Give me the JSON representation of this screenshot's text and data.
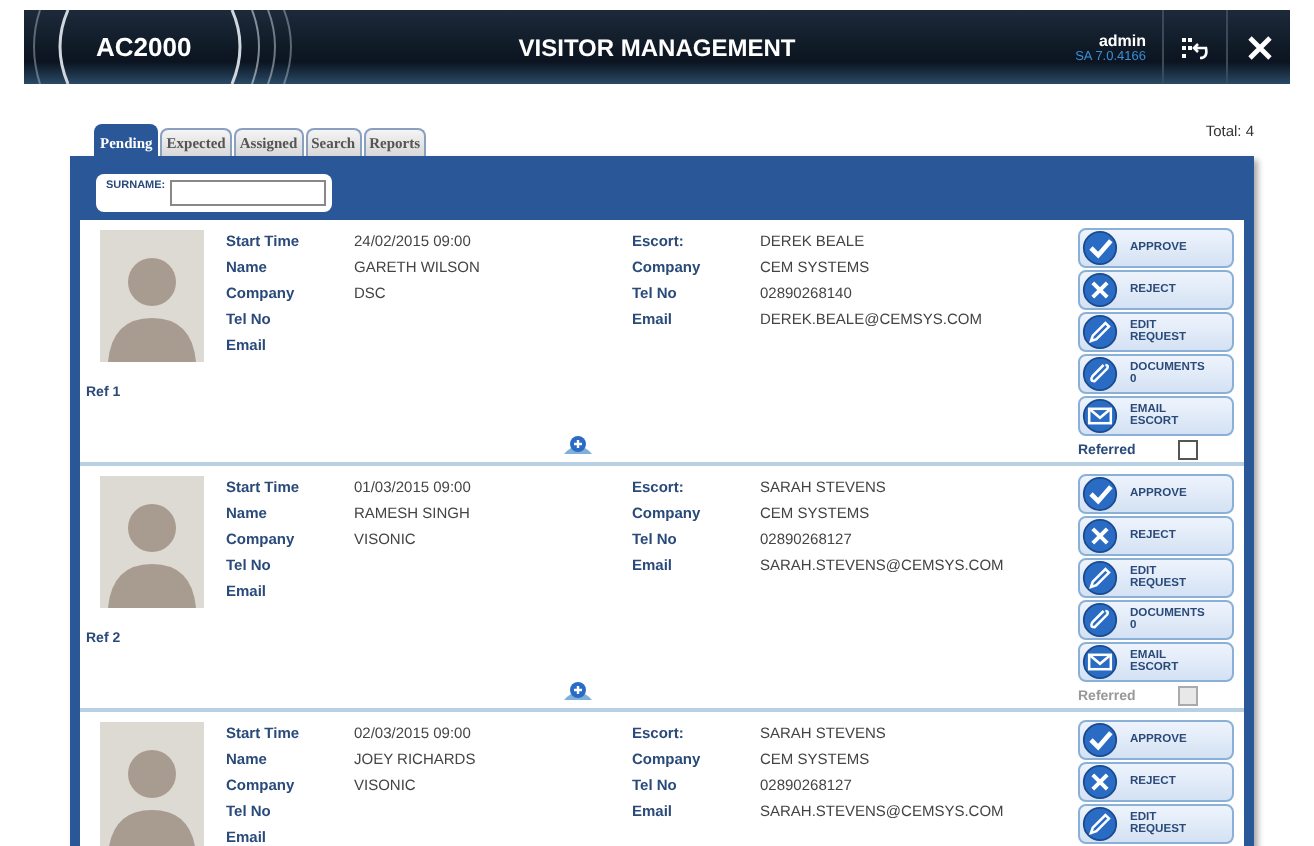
{
  "header": {
    "logo": "AC2000",
    "title": "VISITOR MANAGEMENT",
    "user": "admin",
    "version": "SA 7.0.4166"
  },
  "tabs": [
    {
      "label": "Pending",
      "selected": true
    },
    {
      "label": "Expected",
      "selected": false
    },
    {
      "label": "Assigned",
      "selected": false
    },
    {
      "label": "Search",
      "selected": false
    },
    {
      "label": "Reports",
      "selected": false
    }
  ],
  "total": "Total: 4",
  "filter": {
    "label": "SURNAME:"
  },
  "visitors": [
    {
      "ref": "Ref 1",
      "visitor_fields": [
        {
          "label": "Start Time",
          "value": "24/02/2015 09:00"
        },
        {
          "label": "Name",
          "value": "GARETH WILSON"
        },
        {
          "label": "Company",
          "value": "DSC"
        },
        {
          "label": "Tel No"
        },
        {
          "label": "Email"
        }
      ],
      "escort_fields": [
        {
          "label": "Escort:",
          "value": "DEREK BEALE"
        },
        {
          "label": "Company",
          "value": "CEM SYSTEMS"
        },
        {
          "label": "Tel No",
          "value": "02890268140"
        },
        {
          "label": "Email",
          "value": "DEREK.BEALE@CEMSYS.COM"
        }
      ],
      "actions": [
        {
          "kind": "approve",
          "lines": [
            "APPROVE"
          ]
        },
        {
          "kind": "reject",
          "lines": [
            "REJECT"
          ]
        },
        {
          "kind": "edit",
          "lines": [
            "EDIT",
            "REQUEST"
          ]
        },
        {
          "kind": "documents",
          "lines": [
            "DOCUMENTS",
            "0"
          ]
        },
        {
          "kind": "email",
          "lines": [
            "EMAIL",
            "ESCORT"
          ]
        }
      ],
      "referred": {
        "label": "Referred",
        "checked": false,
        "disabled": false
      }
    },
    {
      "ref": "Ref 2",
      "visitor_fields": [
        {
          "label": "Start Time",
          "value": "01/03/2015 09:00"
        },
        {
          "label": "Name",
          "value": "RAMESH SINGH"
        },
        {
          "label": "Company",
          "value": "VISONIC"
        },
        {
          "label": "Tel No"
        },
        {
          "label": "Email"
        }
      ],
      "escort_fields": [
        {
          "label": "Escort:",
          "value": "SARAH STEVENS"
        },
        {
          "label": "Company",
          "value": "CEM SYSTEMS"
        },
        {
          "label": "Tel No",
          "value": "02890268127"
        },
        {
          "label": "Email",
          "value": "SARAH.STEVENS@CEMSYS.COM"
        }
      ],
      "actions": [
        {
          "kind": "approve",
          "lines": [
            "APPROVE"
          ]
        },
        {
          "kind": "reject",
          "lines": [
            "REJECT"
          ]
        },
        {
          "kind": "edit",
          "lines": [
            "EDIT",
            "REQUEST"
          ]
        },
        {
          "kind": "documents",
          "lines": [
            "DOCUMENTS",
            "0"
          ]
        },
        {
          "kind": "email",
          "lines": [
            "EMAIL",
            "ESCORT"
          ]
        }
      ],
      "referred": {
        "label": "Referred",
        "checked": false,
        "disabled": true
      }
    },
    {
      "visitor_fields": [
        {
          "label": "Start Time",
          "value": "02/03/2015 09:00"
        },
        {
          "label": "Name",
          "value": "JOEY RICHARDS"
        },
        {
          "label": "Company",
          "value": "VISONIC"
        },
        {
          "label": "Tel No"
        },
        {
          "label": "Email"
        }
      ],
      "escort_fields": [
        {
          "label": "Escort:",
          "value": "SARAH STEVENS"
        },
        {
          "label": "Company",
          "value": "CEM SYSTEMS"
        },
        {
          "label": "Tel No",
          "value": "02890268127"
        },
        {
          "label": "Email",
          "value": "SARAH.STEVENS@CEMSYS.COM"
        }
      ],
      "actions": [
        {
          "kind": "approve",
          "lines": [
            "APPROVE"
          ]
        },
        {
          "kind": "reject",
          "lines": [
            "REJECT"
          ]
        },
        {
          "kind": "edit",
          "lines": [
            "EDIT",
            "REQUEST"
          ]
        }
      ]
    }
  ]
}
